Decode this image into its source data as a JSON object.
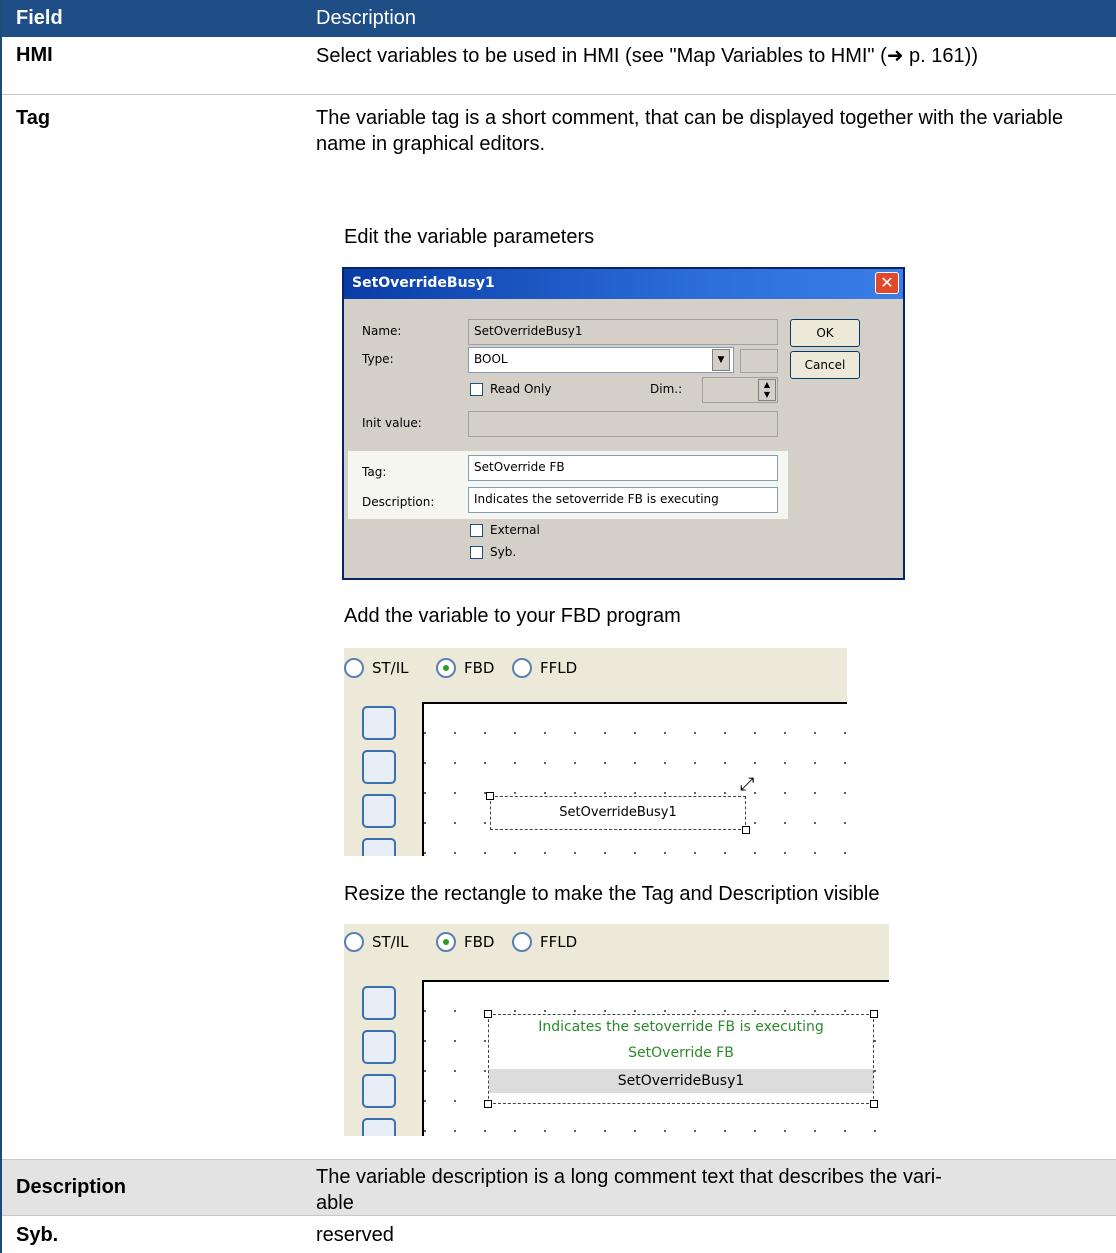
{
  "table": {
    "header": {
      "field": "Field",
      "description": "Description"
    },
    "rows": [
      {
        "field": "HMI",
        "description": "Select variables to be used in HMI (see \"Map Variables to HMI\" (➜ p. 161))"
      },
      {
        "field": "Tag",
        "description": "The variable tag is a short comment, that can be displayed together with the variable name in graphical editors."
      },
      {
        "field": "Description",
        "description_line1": "The variable description is a long comment text that describes the vari-",
        "description_line2": "able"
      },
      {
        "field": "Syb.",
        "description": "reserved"
      }
    ]
  },
  "steps": {
    "edit": "Edit the variable parameters",
    "add": "Add the variable to your FBD program",
    "resize": "Resize the rectangle to make the Tag and Description visible"
  },
  "dialog": {
    "title": "SetOverrideBusy1",
    "close": "✕",
    "labels": {
      "name": "Name:",
      "type": "Type:",
      "init": "Init value:",
      "tag": "Tag:",
      "description": "Description:",
      "dim": "Dim.:"
    },
    "values": {
      "name": "SetOverrideBusy1",
      "type": "BOOL",
      "init": "",
      "tag": "SetOverride FB",
      "description": "Indicates the setoverride FB is executing"
    },
    "checkboxes": {
      "read_only": "Read Only",
      "external": "External",
      "syb": "Syb."
    },
    "buttons": {
      "ok": "OK",
      "cancel": "Cancel"
    }
  },
  "fbd": {
    "radios": [
      "ST/IL",
      "FBD",
      "FFLD"
    ],
    "selected": "FBD",
    "var_name": "SetOverrideBusy1",
    "tag": "SetOverride FB",
    "description": "Indicates the setoverride FB is executing"
  },
  "colors": {
    "header_bg": "#1f4e86",
    "green_text": "#2a8a2a"
  }
}
